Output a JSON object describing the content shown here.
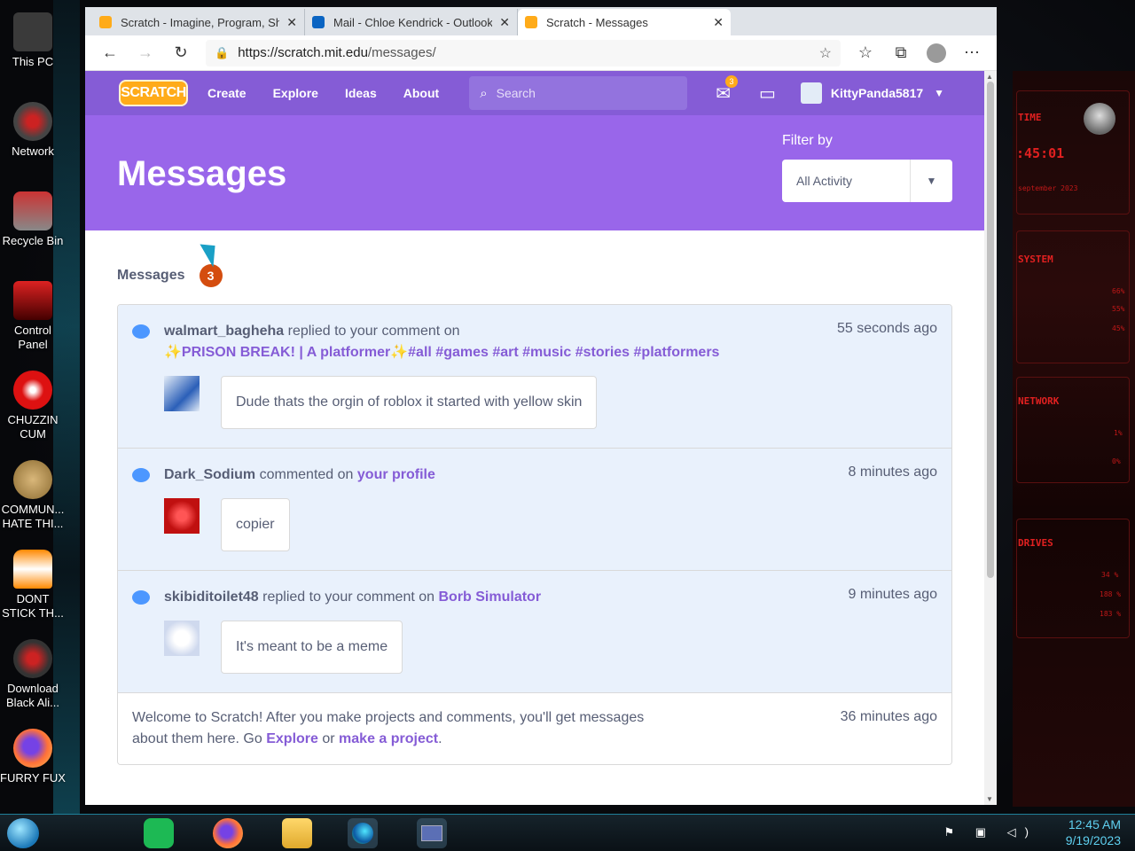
{
  "desktop": {
    "icons": [
      {
        "label": "This PC"
      },
      {
        "label": "Network"
      },
      {
        "label": "Recycle Bin"
      },
      {
        "label": "Control Panel"
      },
      {
        "label": "CHUZZIN CUM"
      },
      {
        "label": "COMMUN... HATE THI..."
      },
      {
        "label": "DONT STICK TH..."
      },
      {
        "label": "Download Black Ali..."
      },
      {
        "label": "FURRY FUX"
      }
    ],
    "hud": {
      "time_label": "TIME",
      "time": ":45:01",
      "date": "september 2023",
      "system_label": "SYSTEM",
      "network_label": "NETWORK",
      "drives_label": "DRIVES",
      "stats": [
        "66%",
        "55%",
        "45%",
        "1%",
        "0%",
        "34 %",
        "188 %",
        "183 %"
      ]
    }
  },
  "browser": {
    "tabs": [
      {
        "title": "Scratch - Imagine, Program, Sha",
        "active": false
      },
      {
        "title": "Mail - Chloe Kendrick - Outlook",
        "active": false
      },
      {
        "title": "Scratch - Messages",
        "active": true
      }
    ],
    "url_host": "https://scratch.mit.edu",
    "url_path": "/messages/"
  },
  "scratch": {
    "logo": "SCRATCH",
    "nav": [
      "Create",
      "Explore",
      "Ideas",
      "About"
    ],
    "search_placeholder": "Search",
    "mail_badge": "3",
    "username": "KittyPanda5817",
    "page_title": "Messages",
    "filter_label": "Filter by",
    "filter_value": "All Activity",
    "messages_heading": "Messages",
    "messages_count": "3",
    "messages": [
      {
        "user": "walmart_bagheha",
        "action": "replied to your comment on",
        "project": "✨PRISON BREAK! | A platformer✨#all #games #art #music #stories #platformers",
        "time": "55 seconds ago",
        "comment": "Dude thats the orgin of roblox it started with yellow skin"
      },
      {
        "user": "Dark_Sodium",
        "action": "commented on",
        "project": "your profile",
        "time": "8 minutes ago",
        "comment": "copier"
      },
      {
        "user": "skibiditoilet48",
        "action": "replied to your comment on",
        "project": "Borb Simulator",
        "time": "9 minutes ago",
        "comment": "It's meant to be a meme"
      }
    ],
    "welcome": {
      "text1": "Welcome to Scratch! After you make projects and comments, you'll get messages about them here. Go",
      "explore": "Explore",
      "or": "or",
      "make": "make a project",
      "period": ".",
      "time": "36 minutes ago"
    }
  },
  "taskbar": {
    "time": "12:45 AM",
    "date": "9/19/2023"
  },
  "colors": {
    "scratch_nav": "#855cd6",
    "scratch_banner": "#9966ea",
    "message_bg": "#e9f1fc",
    "badge": "#d44d0f"
  }
}
